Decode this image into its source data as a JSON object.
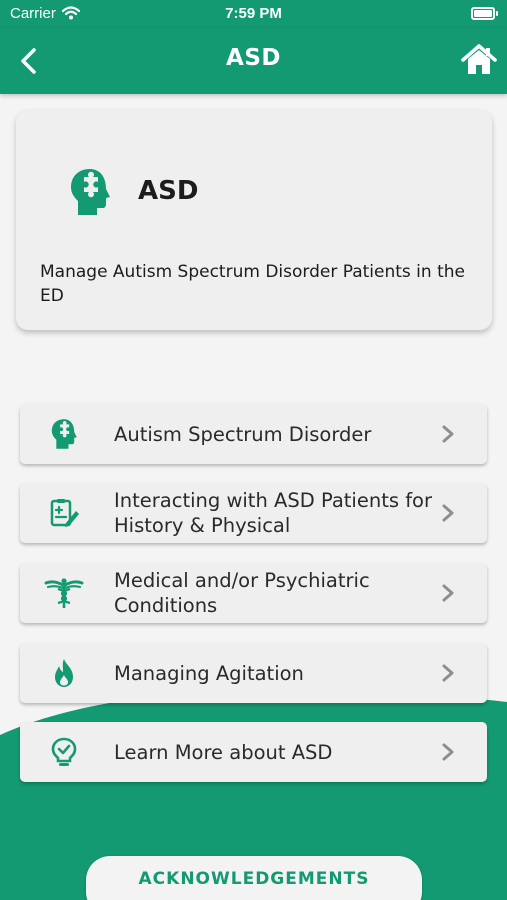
{
  "status_bar": {
    "carrier": "Carrier",
    "time": "7:59 PM"
  },
  "nav": {
    "title": "ASD",
    "back_icon": "chevron-left-icon",
    "home_icon": "home-icon"
  },
  "header_card": {
    "icon": "head-puzzle-icon",
    "title": "ASD",
    "description": "Manage Autism Spectrum Disorder Patients in the ED"
  },
  "menu": {
    "items": [
      {
        "label": "Autism Spectrum Disorder",
        "icon": "head-puzzle-icon"
      },
      {
        "label": "Interacting with ASD Patients for History & Physical",
        "icon": "clipboard-pen-icon"
      },
      {
        "label": "Medical and/or Psychiatric Conditions",
        "icon": "caduceus-icon"
      },
      {
        "label": "Managing Agitation",
        "icon": "flame-icon"
      },
      {
        "label": "Learn More about ASD",
        "icon": "lightbulb-check-icon"
      }
    ]
  },
  "footer": {
    "acknowledgements_label": "ACKNOWLEDGEMENTS"
  },
  "colors": {
    "brand_green": "#139a72",
    "card_background": "#efefef",
    "chevron_gray": "#8e8e8e"
  }
}
